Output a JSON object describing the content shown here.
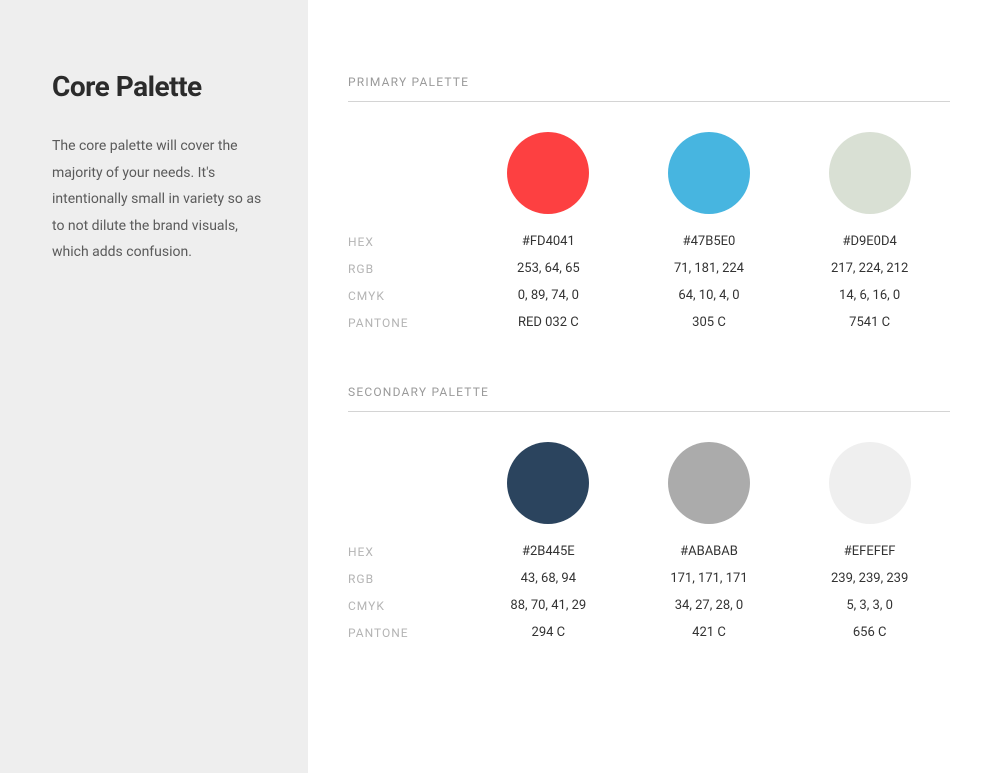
{
  "sidebar": {
    "title": "Core Palette",
    "description": "The core palette will cover the majority of your needs. It's intentionally small in variety so as to not dilute the brand visuals, which adds confusion."
  },
  "sections": [
    {
      "header": "PRIMARY PALETTE",
      "labels": {
        "hex": "HEX",
        "rgb": "RGB",
        "cmyk": "CMYK",
        "pantone": "PANTONE"
      },
      "swatches": [
        {
          "color": "#FD4041",
          "hex": "#FD4041",
          "rgb": "253, 64, 65",
          "cmyk": "0, 89, 74, 0",
          "pantone": "RED 032 C"
        },
        {
          "color": "#47B5E0",
          "hex": "#47B5E0",
          "rgb": "71, 181, 224",
          "cmyk": "64, 10, 4, 0",
          "pantone": "305 C"
        },
        {
          "color": "#D9E0D4",
          "hex": "#D9E0D4",
          "rgb": "217, 224, 212",
          "cmyk": "14, 6, 16, 0",
          "pantone": "7541 C"
        }
      ]
    },
    {
      "header": "SECONDARY PALETTE",
      "labels": {
        "hex": "HEX",
        "rgb": "RGB",
        "cmyk": "CMYK",
        "pantone": "PANTONE"
      },
      "swatches": [
        {
          "color": "#2B445E",
          "hex": "#2B445E",
          "rgb": "43, 68, 94",
          "cmyk": "88, 70, 41, 29",
          "pantone": "294 C"
        },
        {
          "color": "#ABABAB",
          "hex": "#ABABAB",
          "rgb": "171, 171, 171",
          "cmyk": "34, 27, 28, 0",
          "pantone": "421 C"
        },
        {
          "color": "#EFEFEF",
          "hex": "#EFEFEF",
          "rgb": "239, 239, 239",
          "cmyk": "5, 3, 3, 0",
          "pantone": "656 C"
        }
      ]
    }
  ]
}
